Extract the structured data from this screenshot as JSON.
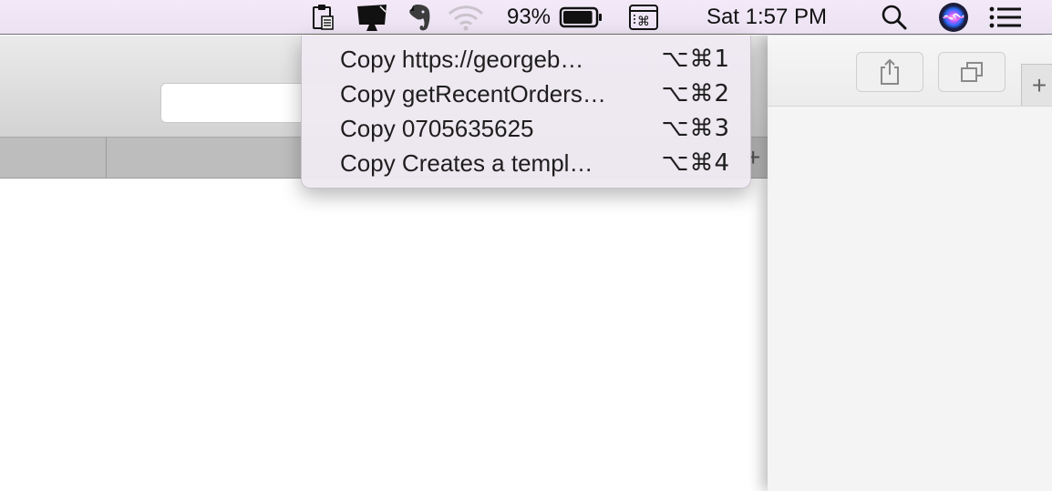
{
  "menubar": {
    "battery_percent": "93%",
    "battery_level": 0.93,
    "clock": "Sat 1:57 PM",
    "icons": [
      "clipboard-icon",
      "display-icon",
      "evernote-elephant-icon",
      "wifi-icon",
      "battery-icon",
      "keyboard-shortcuts-icon",
      "spotlight-search-icon",
      "siri-icon",
      "notification-center-icon"
    ]
  },
  "dropdown": {
    "items": [
      {
        "label": "Copy https://georgeb…",
        "shortcut": "⌥⌘1"
      },
      {
        "label": "Copy getRecentOrders…",
        "shortcut": "⌥⌘2"
      },
      {
        "label": "Copy 0705635625",
        "shortcut": "⌥⌘3"
      },
      {
        "label": "Copy Creates a templ…",
        "shortcut": "⌥⌘4"
      }
    ]
  },
  "colors": {
    "menubar_bg": "#ebe2f2",
    "menu_bg": "#eee8f2",
    "toolbar_bg": "#d3d3d3",
    "tabstrip_bg": "#bdbdbd"
  }
}
